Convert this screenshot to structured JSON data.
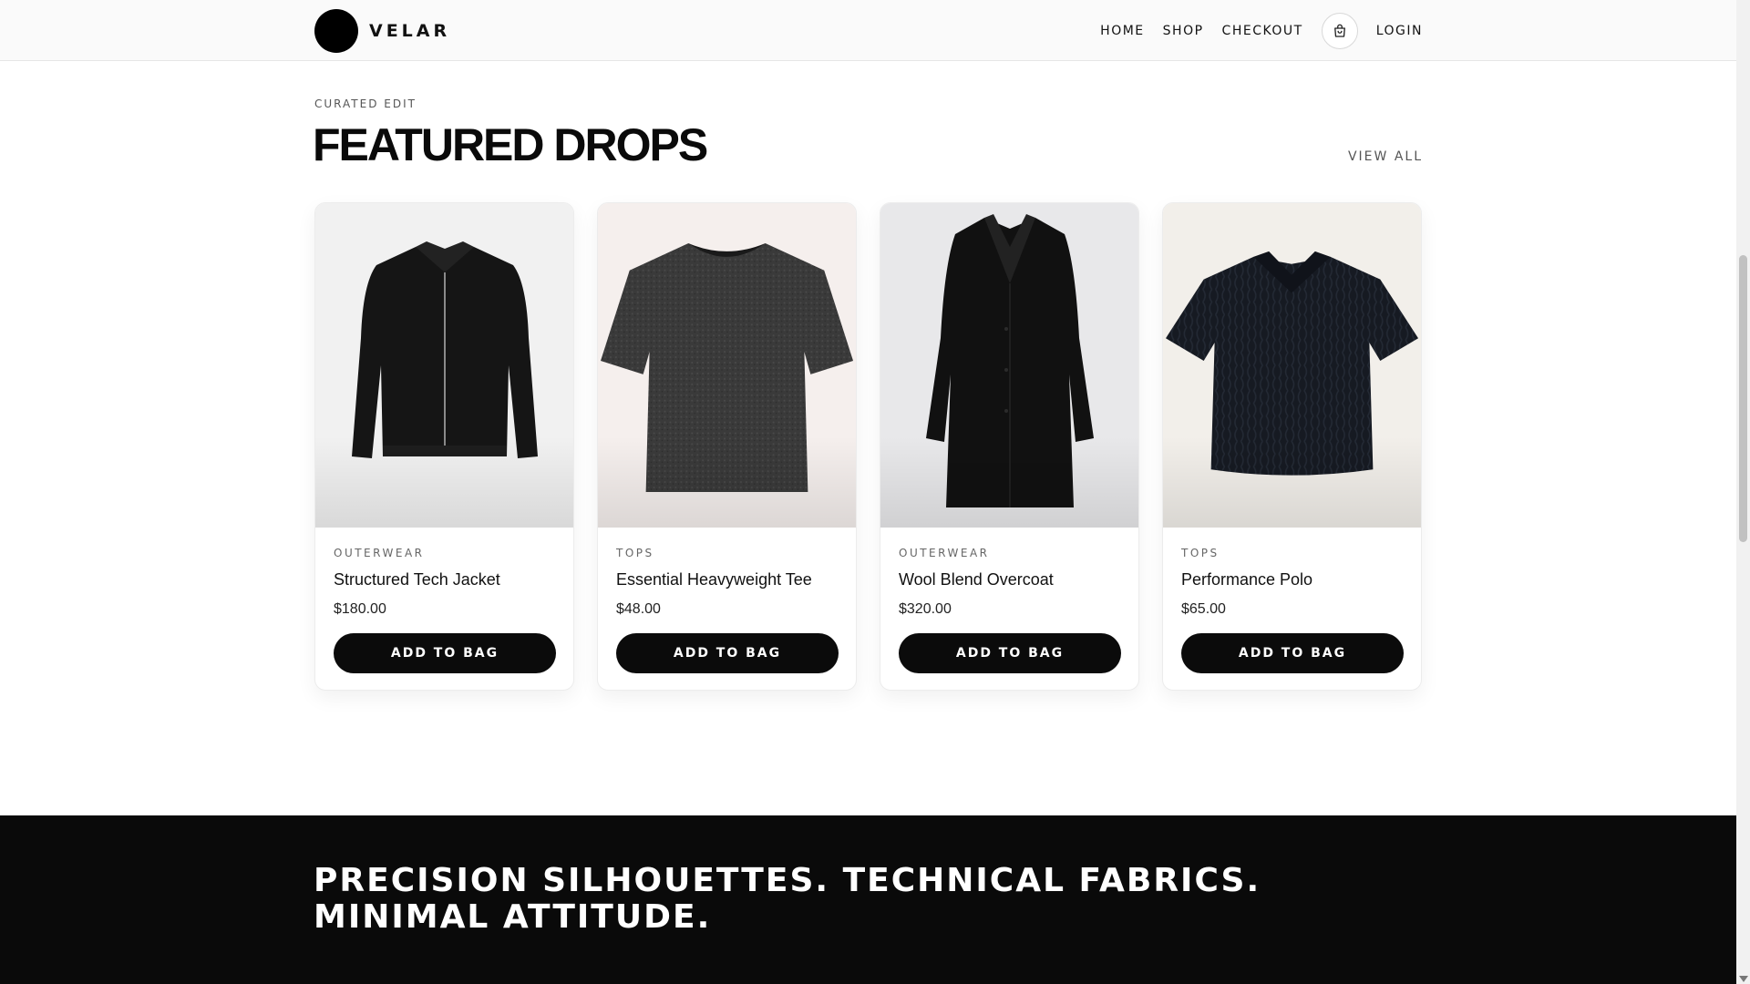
{
  "nav": {
    "brand": "VELAR",
    "links": [
      "HOME",
      "SHOP",
      "CHECKOUT"
    ],
    "cart_icon": "shopping-bag-icon",
    "login": "LOGIN"
  },
  "section": {
    "eyebrow": "CURATED EDIT",
    "title": "FEATURED DROPS",
    "view_all": "VIEW ALL"
  },
  "products": [
    {
      "category": "OUTERWEAR",
      "name": "Structured Tech Jacket",
      "price": "$180.00",
      "button": "ADD TO BAG",
      "image_icon": "jacket-image"
    },
    {
      "category": "TOPS",
      "name": "Essential Heavyweight Tee",
      "price": "$48.00",
      "button": "ADD TO BAG",
      "image_icon": "tshirt-image"
    },
    {
      "category": "OUTERWEAR",
      "name": "Wool Blend Overcoat",
      "price": "$320.00",
      "button": "ADD TO BAG",
      "image_icon": "overcoat-image"
    },
    {
      "category": "TOPS",
      "name": "Performance Polo",
      "price": "$65.00",
      "button": "ADD TO BAG",
      "image_icon": "polo-image"
    }
  ],
  "band": {
    "text": "PRECISION SILHOUETTES. TECHNICAL FABRICS. MINIMAL ATTITUDE."
  },
  "colors": {
    "accent": "#0b0b0b",
    "band_bg": "#0a0a0a",
    "page_bg": "#ffffff"
  }
}
